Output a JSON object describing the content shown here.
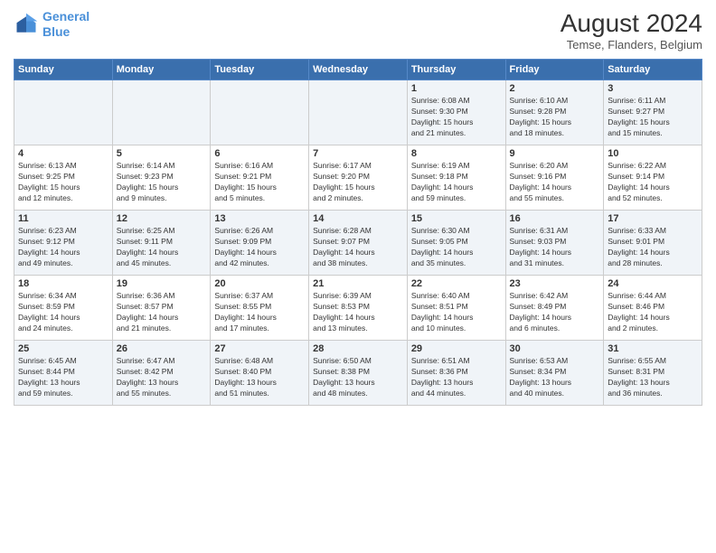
{
  "header": {
    "logo_line1": "General",
    "logo_line2": "Blue",
    "month_year": "August 2024",
    "location": "Temse, Flanders, Belgium"
  },
  "weekdays": [
    "Sunday",
    "Monday",
    "Tuesday",
    "Wednesday",
    "Thursday",
    "Friday",
    "Saturday"
  ],
  "weeks": [
    [
      {
        "day": "",
        "detail": ""
      },
      {
        "day": "",
        "detail": ""
      },
      {
        "day": "",
        "detail": ""
      },
      {
        "day": "",
        "detail": ""
      },
      {
        "day": "1",
        "detail": "Sunrise: 6:08 AM\nSunset: 9:30 PM\nDaylight: 15 hours\nand 21 minutes."
      },
      {
        "day": "2",
        "detail": "Sunrise: 6:10 AM\nSunset: 9:28 PM\nDaylight: 15 hours\nand 18 minutes."
      },
      {
        "day": "3",
        "detail": "Sunrise: 6:11 AM\nSunset: 9:27 PM\nDaylight: 15 hours\nand 15 minutes."
      }
    ],
    [
      {
        "day": "4",
        "detail": "Sunrise: 6:13 AM\nSunset: 9:25 PM\nDaylight: 15 hours\nand 12 minutes."
      },
      {
        "day": "5",
        "detail": "Sunrise: 6:14 AM\nSunset: 9:23 PM\nDaylight: 15 hours\nand 9 minutes."
      },
      {
        "day": "6",
        "detail": "Sunrise: 6:16 AM\nSunset: 9:21 PM\nDaylight: 15 hours\nand 5 minutes."
      },
      {
        "day": "7",
        "detail": "Sunrise: 6:17 AM\nSunset: 9:20 PM\nDaylight: 15 hours\nand 2 minutes."
      },
      {
        "day": "8",
        "detail": "Sunrise: 6:19 AM\nSunset: 9:18 PM\nDaylight: 14 hours\nand 59 minutes."
      },
      {
        "day": "9",
        "detail": "Sunrise: 6:20 AM\nSunset: 9:16 PM\nDaylight: 14 hours\nand 55 minutes."
      },
      {
        "day": "10",
        "detail": "Sunrise: 6:22 AM\nSunset: 9:14 PM\nDaylight: 14 hours\nand 52 minutes."
      }
    ],
    [
      {
        "day": "11",
        "detail": "Sunrise: 6:23 AM\nSunset: 9:12 PM\nDaylight: 14 hours\nand 49 minutes."
      },
      {
        "day": "12",
        "detail": "Sunrise: 6:25 AM\nSunset: 9:11 PM\nDaylight: 14 hours\nand 45 minutes."
      },
      {
        "day": "13",
        "detail": "Sunrise: 6:26 AM\nSunset: 9:09 PM\nDaylight: 14 hours\nand 42 minutes."
      },
      {
        "day": "14",
        "detail": "Sunrise: 6:28 AM\nSunset: 9:07 PM\nDaylight: 14 hours\nand 38 minutes."
      },
      {
        "day": "15",
        "detail": "Sunrise: 6:30 AM\nSunset: 9:05 PM\nDaylight: 14 hours\nand 35 minutes."
      },
      {
        "day": "16",
        "detail": "Sunrise: 6:31 AM\nSunset: 9:03 PM\nDaylight: 14 hours\nand 31 minutes."
      },
      {
        "day": "17",
        "detail": "Sunrise: 6:33 AM\nSunset: 9:01 PM\nDaylight: 14 hours\nand 28 minutes."
      }
    ],
    [
      {
        "day": "18",
        "detail": "Sunrise: 6:34 AM\nSunset: 8:59 PM\nDaylight: 14 hours\nand 24 minutes."
      },
      {
        "day": "19",
        "detail": "Sunrise: 6:36 AM\nSunset: 8:57 PM\nDaylight: 14 hours\nand 21 minutes."
      },
      {
        "day": "20",
        "detail": "Sunrise: 6:37 AM\nSunset: 8:55 PM\nDaylight: 14 hours\nand 17 minutes."
      },
      {
        "day": "21",
        "detail": "Sunrise: 6:39 AM\nSunset: 8:53 PM\nDaylight: 14 hours\nand 13 minutes."
      },
      {
        "day": "22",
        "detail": "Sunrise: 6:40 AM\nSunset: 8:51 PM\nDaylight: 14 hours\nand 10 minutes."
      },
      {
        "day": "23",
        "detail": "Sunrise: 6:42 AM\nSunset: 8:49 PM\nDaylight: 14 hours\nand 6 minutes."
      },
      {
        "day": "24",
        "detail": "Sunrise: 6:44 AM\nSunset: 8:46 PM\nDaylight: 14 hours\nand 2 minutes."
      }
    ],
    [
      {
        "day": "25",
        "detail": "Sunrise: 6:45 AM\nSunset: 8:44 PM\nDaylight: 13 hours\nand 59 minutes."
      },
      {
        "day": "26",
        "detail": "Sunrise: 6:47 AM\nSunset: 8:42 PM\nDaylight: 13 hours\nand 55 minutes."
      },
      {
        "day": "27",
        "detail": "Sunrise: 6:48 AM\nSunset: 8:40 PM\nDaylight: 13 hours\nand 51 minutes."
      },
      {
        "day": "28",
        "detail": "Sunrise: 6:50 AM\nSunset: 8:38 PM\nDaylight: 13 hours\nand 48 minutes."
      },
      {
        "day": "29",
        "detail": "Sunrise: 6:51 AM\nSunset: 8:36 PM\nDaylight: 13 hours\nand 44 minutes."
      },
      {
        "day": "30",
        "detail": "Sunrise: 6:53 AM\nSunset: 8:34 PM\nDaylight: 13 hours\nand 40 minutes."
      },
      {
        "day": "31",
        "detail": "Sunrise: 6:55 AM\nSunset: 8:31 PM\nDaylight: 13 hours\nand 36 minutes."
      }
    ]
  ]
}
